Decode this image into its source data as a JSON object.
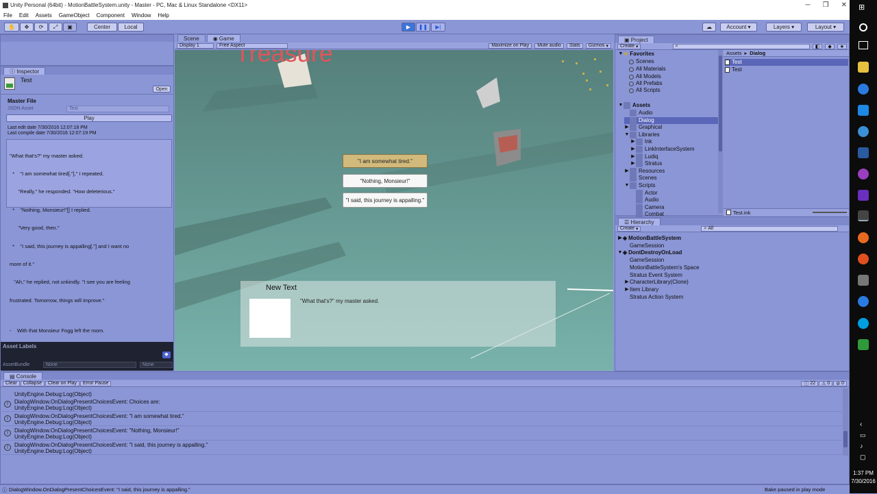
{
  "window": {
    "title": "Unity Personal (64bit) - MotionBattleSystem.unity - Master - PC, Mac & Linux Standalone <DX11>"
  },
  "menu": [
    "File",
    "Edit",
    "Assets",
    "GameObject",
    "Component",
    "Window",
    "Help"
  ],
  "toolbar": {
    "pivot_label": "Center",
    "space_label": "Local",
    "account_label": "Account",
    "layers_label": "Layers",
    "layout_label": "Layout"
  },
  "scene_tabs": {
    "scene": "Scene",
    "game": "Game",
    "display": "Display 1",
    "aspect": "Free Aspect",
    "maximize": "Maximize on Play",
    "mute": "Mute audio",
    "stats": "Stats",
    "gizmos": "Gizmos"
  },
  "inspector": {
    "tab": "Inspector",
    "object_name": "Test",
    "open_label": "Open",
    "master_file_label": "Master File",
    "json_asset_label": "JSON Asset",
    "json_asset_value": "Test",
    "play_label": "Play",
    "last_edit": "Last edit date 7/30/2016 12:07:18 PM",
    "last_compile": "Last compile date 7/30/2016 12:07:19 PM",
    "story_lines": [
      "\"What that's?\" my master asked.",
      "  *    \"I am somewhat tired[.\"],\" I repeated.",
      "      \"Really,\" he responded. \"How deleterious.\"",
      "  *    \"Nothing, Monsieur!\"[] I replied.",
      "      \"Very good, then.\"",
      "  *    \"I said, this journey is appalling[.\"] and I want no",
      "more of it.\"",
      "   \"Ah,\" he replied, not unkindly. \"I see you are feeling",
      "frustrated. Tomorrow, things will improve.\"",
      "",
      "-    With that Monsieur Fogg left the room."
    ],
    "asset_labels": "Asset Labels",
    "assetbundle_label": "AssetBundle",
    "assetbundle_value": "None",
    "assetbundle_variant": "None"
  },
  "game": {
    "title_text": "Treasure",
    "choices": [
      "\"I am somewhat tired.\"",
      "\"Nothing, Monsieur!\"",
      "\"I said, this journey is appalling.\""
    ],
    "dialog_name": "New Text",
    "dialog_text": "\"What that's?\" my master asked."
  },
  "project": {
    "tab": "Project",
    "create": "Create",
    "favorites_label": "Favorites",
    "favorites": [
      "Scenes",
      "All Materials",
      "All Models",
      "All Prefabs",
      "All Scripts"
    ],
    "assets_label": "Assets",
    "tree": [
      {
        "label": "Audio",
        "depth": 1,
        "arrow": ""
      },
      {
        "label": "Dialog",
        "depth": 1,
        "arrow": "",
        "selected": true
      },
      {
        "label": "Graphical",
        "depth": 1,
        "arrow": "▶"
      },
      {
        "label": "Libraries",
        "depth": 1,
        "arrow": "▼"
      },
      {
        "label": "Ink",
        "depth": 2,
        "arrow": "▶"
      },
      {
        "label": "LinkInterfaceSystem",
        "depth": 2,
        "arrow": "▶"
      },
      {
        "label": "Ludiq",
        "depth": 2,
        "arrow": "▶"
      },
      {
        "label": "Stratus",
        "depth": 2,
        "arrow": "▶"
      },
      {
        "label": "Resources",
        "depth": 1,
        "arrow": "▶"
      },
      {
        "label": "Scenes",
        "depth": 1,
        "arrow": ""
      },
      {
        "label": "Scripts",
        "depth": 1,
        "arrow": "▼"
      },
      {
        "label": "Actor",
        "depth": 2,
        "arrow": ""
      },
      {
        "label": "Audio",
        "depth": 2,
        "arrow": ""
      },
      {
        "label": "Camera",
        "depth": 2,
        "arrow": ""
      },
      {
        "label": "Combat",
        "depth": 2,
        "arrow": ""
      }
    ],
    "breadcrumb_root": "Assets",
    "breadcrumb_sep": "▸",
    "breadcrumb_leaf": "Dialog",
    "files": [
      "Test",
      "Test"
    ],
    "selected_path": "Test.ink"
  },
  "hierarchy": {
    "tab": "Hierarchy",
    "create": "Create",
    "search_placeholder": "All",
    "items": [
      {
        "label": "MotionBattleSystem",
        "depth": 0,
        "arrow": "▶",
        "scene": true
      },
      {
        "label": "GameSession",
        "depth": 1,
        "arrow": ""
      },
      {
        "label": "DontDestroyOnLoad",
        "depth": 0,
        "arrow": "▼",
        "scene": true
      },
      {
        "label": "GameSession",
        "depth": 1,
        "arrow": ""
      },
      {
        "label": "MotionBattleSystem's Space",
        "depth": 1,
        "arrow": ""
      },
      {
        "label": "Stratus Event System",
        "depth": 1,
        "arrow": ""
      },
      {
        "label": "CharacterLibrary(Clone)",
        "depth": 1,
        "arrow": "▶"
      },
      {
        "label": "Item Library",
        "depth": 1,
        "arrow": "▶"
      },
      {
        "label": "Stratus Action System",
        "depth": 1,
        "arrow": ""
      }
    ]
  },
  "console": {
    "tab": "Console",
    "buttons": [
      "Clear",
      "Collapse",
      "Clear on Play",
      "Error Pause"
    ],
    "count_log": "22",
    "count_warn": "0",
    "count_err": "0",
    "entries": [
      {
        "l1": "DialogWindow.OnDialogPresentChoicesEvent: Choices are:",
        "l2": "UnityEngine.Debug:Log(Object)"
      },
      {
        "l1": "DialogWindow.OnDialogPresentChoicesEvent: \"I am somewhat tired.\"",
        "l2": "UnityEngine.Debug:Log(Object)"
      },
      {
        "l1": "DialogWindow.OnDialogPresentChoicesEvent: \"Nothing, Monsieur!\"",
        "l2": "UnityEngine.Debug:Log(Object)"
      },
      {
        "l1": "DialogWindow.OnDialogPresentChoicesEvent: \"I said, this journey is appalling.\"",
        "l2": "UnityEngine.Debug:Log(Object)"
      }
    ],
    "top_partial": "UnityEngine.Debug:Log(Object)"
  },
  "status": {
    "message": "DialogWindow.OnDialogPresentChoicesEvent: \"I said, this journey is appalling.\"",
    "bake": "Bake paused in play mode"
  },
  "taskbar": {
    "time": "1:37 PM",
    "date": "7/30/2016"
  },
  "colors": {
    "panel": "#8b96d6",
    "game_bg": "#5f9189",
    "selected": "#5a66b8"
  }
}
